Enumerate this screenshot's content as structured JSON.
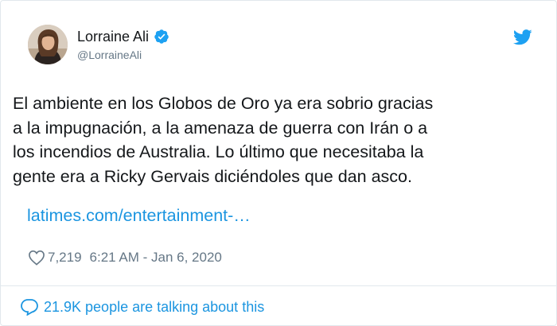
{
  "author": {
    "display_name": "Lorraine Ali",
    "handle": "@LorraineAli",
    "verified": true,
    "avatar_icon": "profile-photo"
  },
  "tweet": {
    "text_lines": [
      "El ambiente en los Globos de Oro ya era sobrio gracias",
      "a la impugnación, a la amenaza de guerra con Irán o a",
      "los incendios de Australia. Lo último que necesitaba la",
      "gente era a Ricky Gervais diciéndoles que dan asco."
    ],
    "link": "latimes.com/entertainment-…"
  },
  "meta": {
    "likes": "7,219",
    "timestamp": "6:21 AM - Jan 6, 2020"
  },
  "footer": {
    "talking": "21.9K people are talking about this"
  },
  "colors": {
    "text": "#14171a",
    "secondary": "#657786",
    "link": "#1b95e0",
    "twitter_blue": "#1da1f2",
    "border": "#e1e8ed"
  },
  "icons": {
    "brand": "twitter-bird-icon",
    "verified": "verified-badge-icon",
    "like": "heart-icon",
    "reply": "speech-bubble-icon"
  }
}
